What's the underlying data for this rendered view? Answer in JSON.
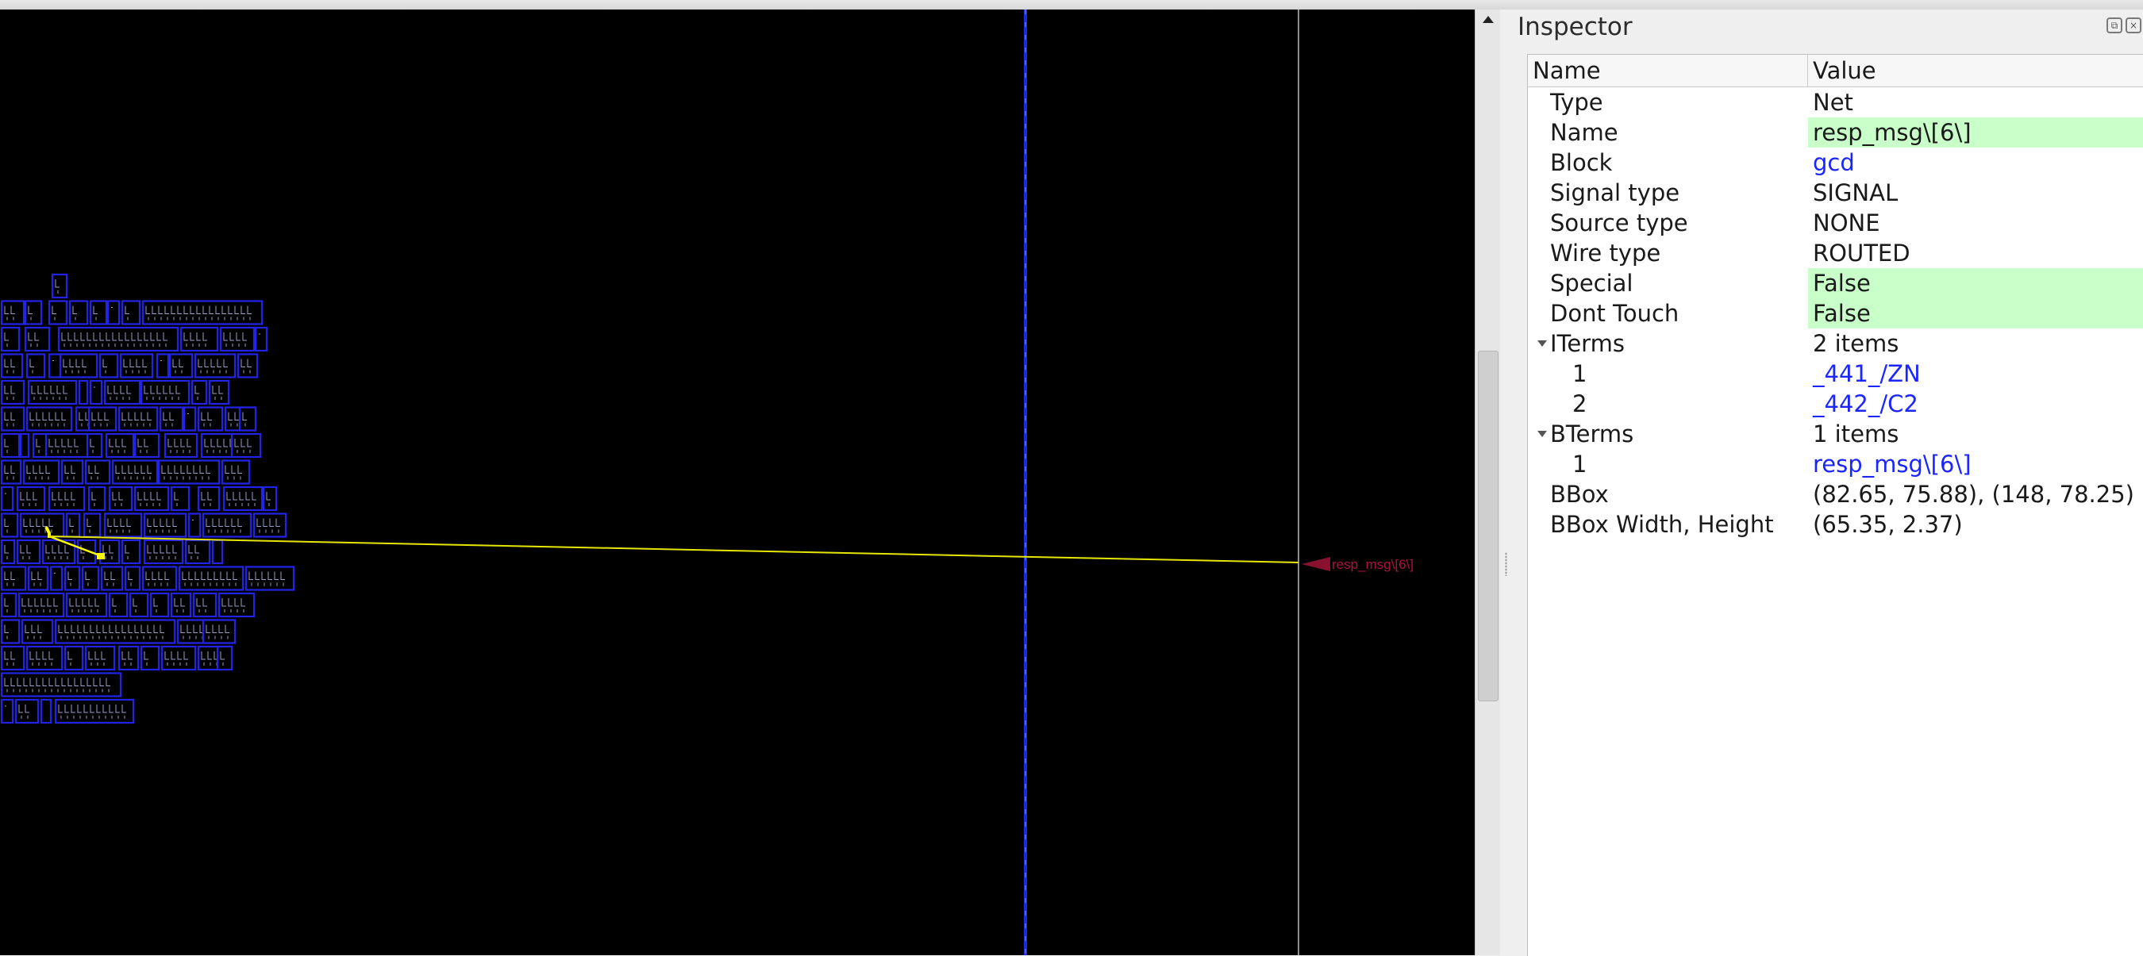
{
  "layout": {
    "pin_label": "resp_msg\\[6\\]",
    "colors": {
      "background": "#000000",
      "cell_outline": "#2323e8",
      "cell_detail": "#9aa0c8",
      "net_highlight": "#ffff00",
      "pin_marker": "#8a1030",
      "rail_blue": "#1e2bd8",
      "die_boundary": "#bdbdbd"
    }
  },
  "inspector": {
    "title": "Inspector",
    "columns": {
      "name": "Name",
      "value": "Value"
    },
    "rows": [
      {
        "name": "Type",
        "value": "Net",
        "indent": 1
      },
      {
        "name": "Name",
        "value": "resp_msg\\[6\\]",
        "indent": 1,
        "highlight": true
      },
      {
        "name": "Block",
        "value": "gcd",
        "indent": 1,
        "link": true
      },
      {
        "name": "Signal type",
        "value": "SIGNAL",
        "indent": 1
      },
      {
        "name": "Source type",
        "value": "NONE",
        "indent": 1
      },
      {
        "name": "Wire type",
        "value": "ROUTED",
        "indent": 1
      },
      {
        "name": "Special",
        "value": "False",
        "indent": 1,
        "highlight": true
      },
      {
        "name": "Dont Touch",
        "value": "False",
        "indent": 1,
        "highlight": true
      },
      {
        "name": "ITerms",
        "value": "2 items",
        "indent": 1,
        "expandable": true
      },
      {
        "name": "1",
        "value": "_441_/ZN",
        "indent": 2,
        "link": true
      },
      {
        "name": "2",
        "value": "_442_/C2",
        "indent": 2,
        "link": true
      },
      {
        "name": "BTerms",
        "value": "1 items",
        "indent": 1,
        "expandable": true
      },
      {
        "name": "1",
        "value": "resp_msg\\[6\\]",
        "indent": 2,
        "link": true
      },
      {
        "name": "BBox",
        "value": "(82.65, 75.88), (148, 78.25)",
        "indent": 1
      },
      {
        "name": "BBox Width, Height",
        "value": "(65.35, 2.37)",
        "indent": 1
      }
    ]
  }
}
